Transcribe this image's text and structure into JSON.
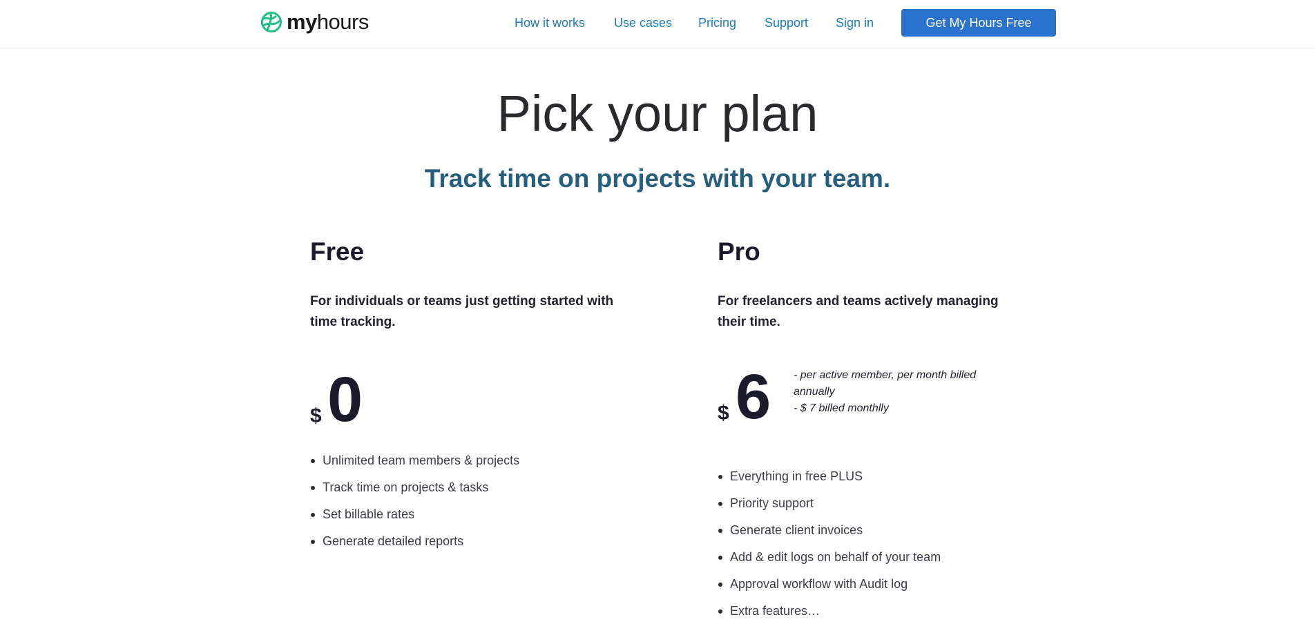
{
  "brand": {
    "name_bold": "my",
    "name_regular": "hours",
    "logo_icon": "myhours-globe-logo",
    "logo_color": "#1fbf86"
  },
  "nav": {
    "links": [
      "How it works",
      "Use cases",
      "Pricing",
      "Support",
      "Sign in"
    ],
    "cta_label": "Get My Hours Free",
    "link_color": "#1e7bc0",
    "cta_color": "#2b72cf"
  },
  "hero": {
    "title": "Pick your plan",
    "subtitle": "Track time on projects with your team.",
    "subtitle_color": "#265f7c"
  },
  "plans": [
    {
      "name": "Free",
      "description": "For individuals or teams just getting started with time tracking.",
      "currency": "$",
      "price": "0",
      "price_notes": [],
      "features": [
        "Unlimited team members & projects",
        "Track time on projects & tasks",
        "Set billable rates",
        "Generate detailed reports"
      ]
    },
    {
      "name": "Pro",
      "description": "For freelancers and teams actively managing their time.",
      "currency": "$",
      "price": "6",
      "price_notes": [
        "- per active member, per month billed annually",
        "- $ 7 billed monthlly"
      ],
      "features": [
        "Everything in free PLUS",
        "Priority support",
        "Generate client invoices",
        "Add & edit logs on behalf of your team",
        "Approval workflow with Audit log",
        "Extra features…"
      ]
    }
  ]
}
